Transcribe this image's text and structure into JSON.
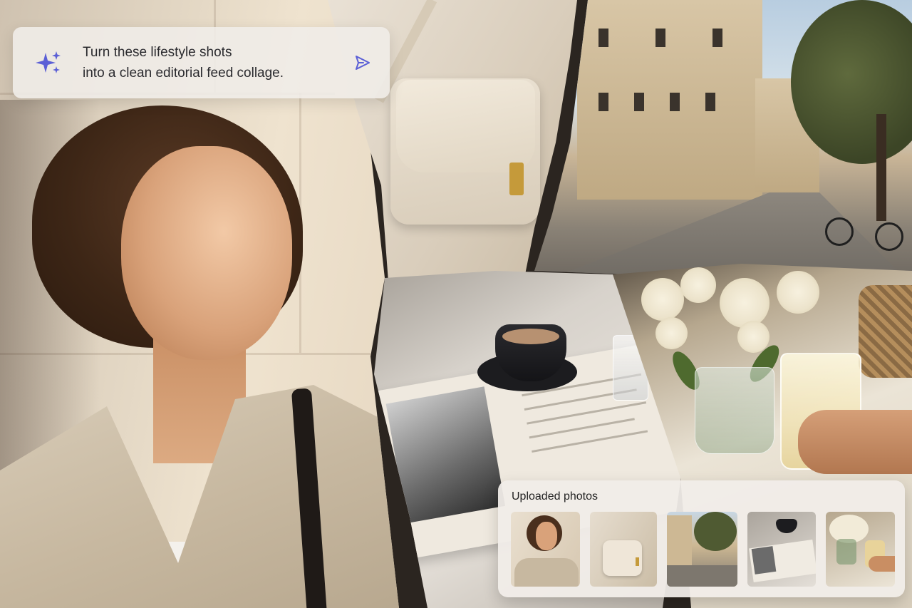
{
  "prompt": {
    "line1": "Turn these lifestyle shots",
    "line2": "into a clean editorial feed collage.",
    "icon": "sparkle-icon",
    "send_icon": "send-icon",
    "accent_color": "#5b5fd6"
  },
  "uploads": {
    "title": "Uploaded photos",
    "thumbnails": [
      {
        "label": "portrait"
      },
      {
        "label": "handbag"
      },
      {
        "label": "street"
      },
      {
        "label": "coffee"
      },
      {
        "label": "flowers"
      }
    ]
  },
  "collage": {
    "photos": [
      "portrait",
      "handbag",
      "street",
      "coffee",
      "flowers"
    ]
  }
}
